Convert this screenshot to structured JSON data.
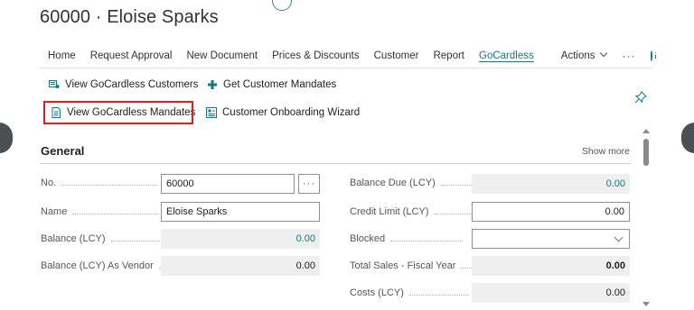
{
  "page": {
    "title": "60000 · Eloise Sparks"
  },
  "actionbar": {
    "tabs": [
      {
        "label": "Home"
      },
      {
        "label": "Request Approval"
      },
      {
        "label": "New Document"
      },
      {
        "label": "Prices & Discounts"
      },
      {
        "label": "Customer"
      },
      {
        "label": "Report"
      },
      {
        "label": "GoCardless",
        "active": true
      }
    ],
    "actions_label": "Actions",
    "more_label": "···"
  },
  "subactions": {
    "view_customers": "View GoCardless Customers",
    "get_mandates": "Get Customer Mandates",
    "view_mandates": "View GoCardless Mandates",
    "onboarding_wizard": "Customer Onboarding Wizard"
  },
  "section": {
    "title": "General",
    "show_more": "Show more"
  },
  "fields_left": {
    "no": {
      "label": "No.",
      "value": "60000"
    },
    "name": {
      "label": "Name",
      "value": "Eloise Sparks"
    },
    "balance_lcy": {
      "label": "Balance (LCY)",
      "value": "0.00"
    },
    "balance_vendor": {
      "label": "Balance (LCY) As Vendor",
      "value": "0.00"
    }
  },
  "fields_right": {
    "balance_due": {
      "label": "Balance Due (LCY)",
      "value": "0.00"
    },
    "credit_limit": {
      "label": "Credit Limit (LCY)",
      "value": "0.00"
    },
    "blocked": {
      "label": "Blocked",
      "value": ""
    },
    "total_sales": {
      "label": "Total Sales - Fiscal Year",
      "value": "0.00"
    },
    "costs": {
      "label": "Costs (LCY)",
      "value": "0.00"
    }
  },
  "colors": {
    "accent": "#0e7c86",
    "highlight": "#e21b1b"
  }
}
